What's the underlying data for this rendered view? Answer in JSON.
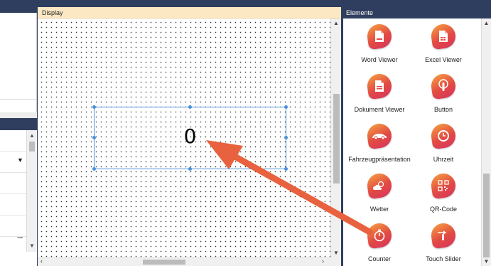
{
  "display": {
    "title": "Display",
    "counter_value": "0"
  },
  "elements_panel": {
    "title": "Elemente",
    "items": [
      {
        "label": "Word Viewer",
        "icon": "word-doc-icon"
      },
      {
        "label": "Excel Viewer",
        "icon": "excel-doc-icon"
      },
      {
        "label": "Dokument Viewer",
        "icon": "document-icon"
      },
      {
        "label": "Button",
        "icon": "touch-button-icon"
      },
      {
        "label": "Fahrzeugpräsentation",
        "icon": "car-icon"
      },
      {
        "label": "Uhrzeit",
        "icon": "clock-icon"
      },
      {
        "label": "Wetter",
        "icon": "weather-icon"
      },
      {
        "label": "QR-Code",
        "icon": "qr-code-icon"
      },
      {
        "label": "Counter",
        "icon": "stopwatch-icon"
      },
      {
        "label": "Touch Slider",
        "icon": "touch-slider-icon"
      }
    ]
  },
  "left_panel": {
    "ellipsis": "..."
  },
  "colors": {
    "accent_arrow": "#e8623f",
    "selection": "#4a90d9",
    "frame": "#2f3e5f",
    "display_title_bg": "#fce9c4"
  }
}
